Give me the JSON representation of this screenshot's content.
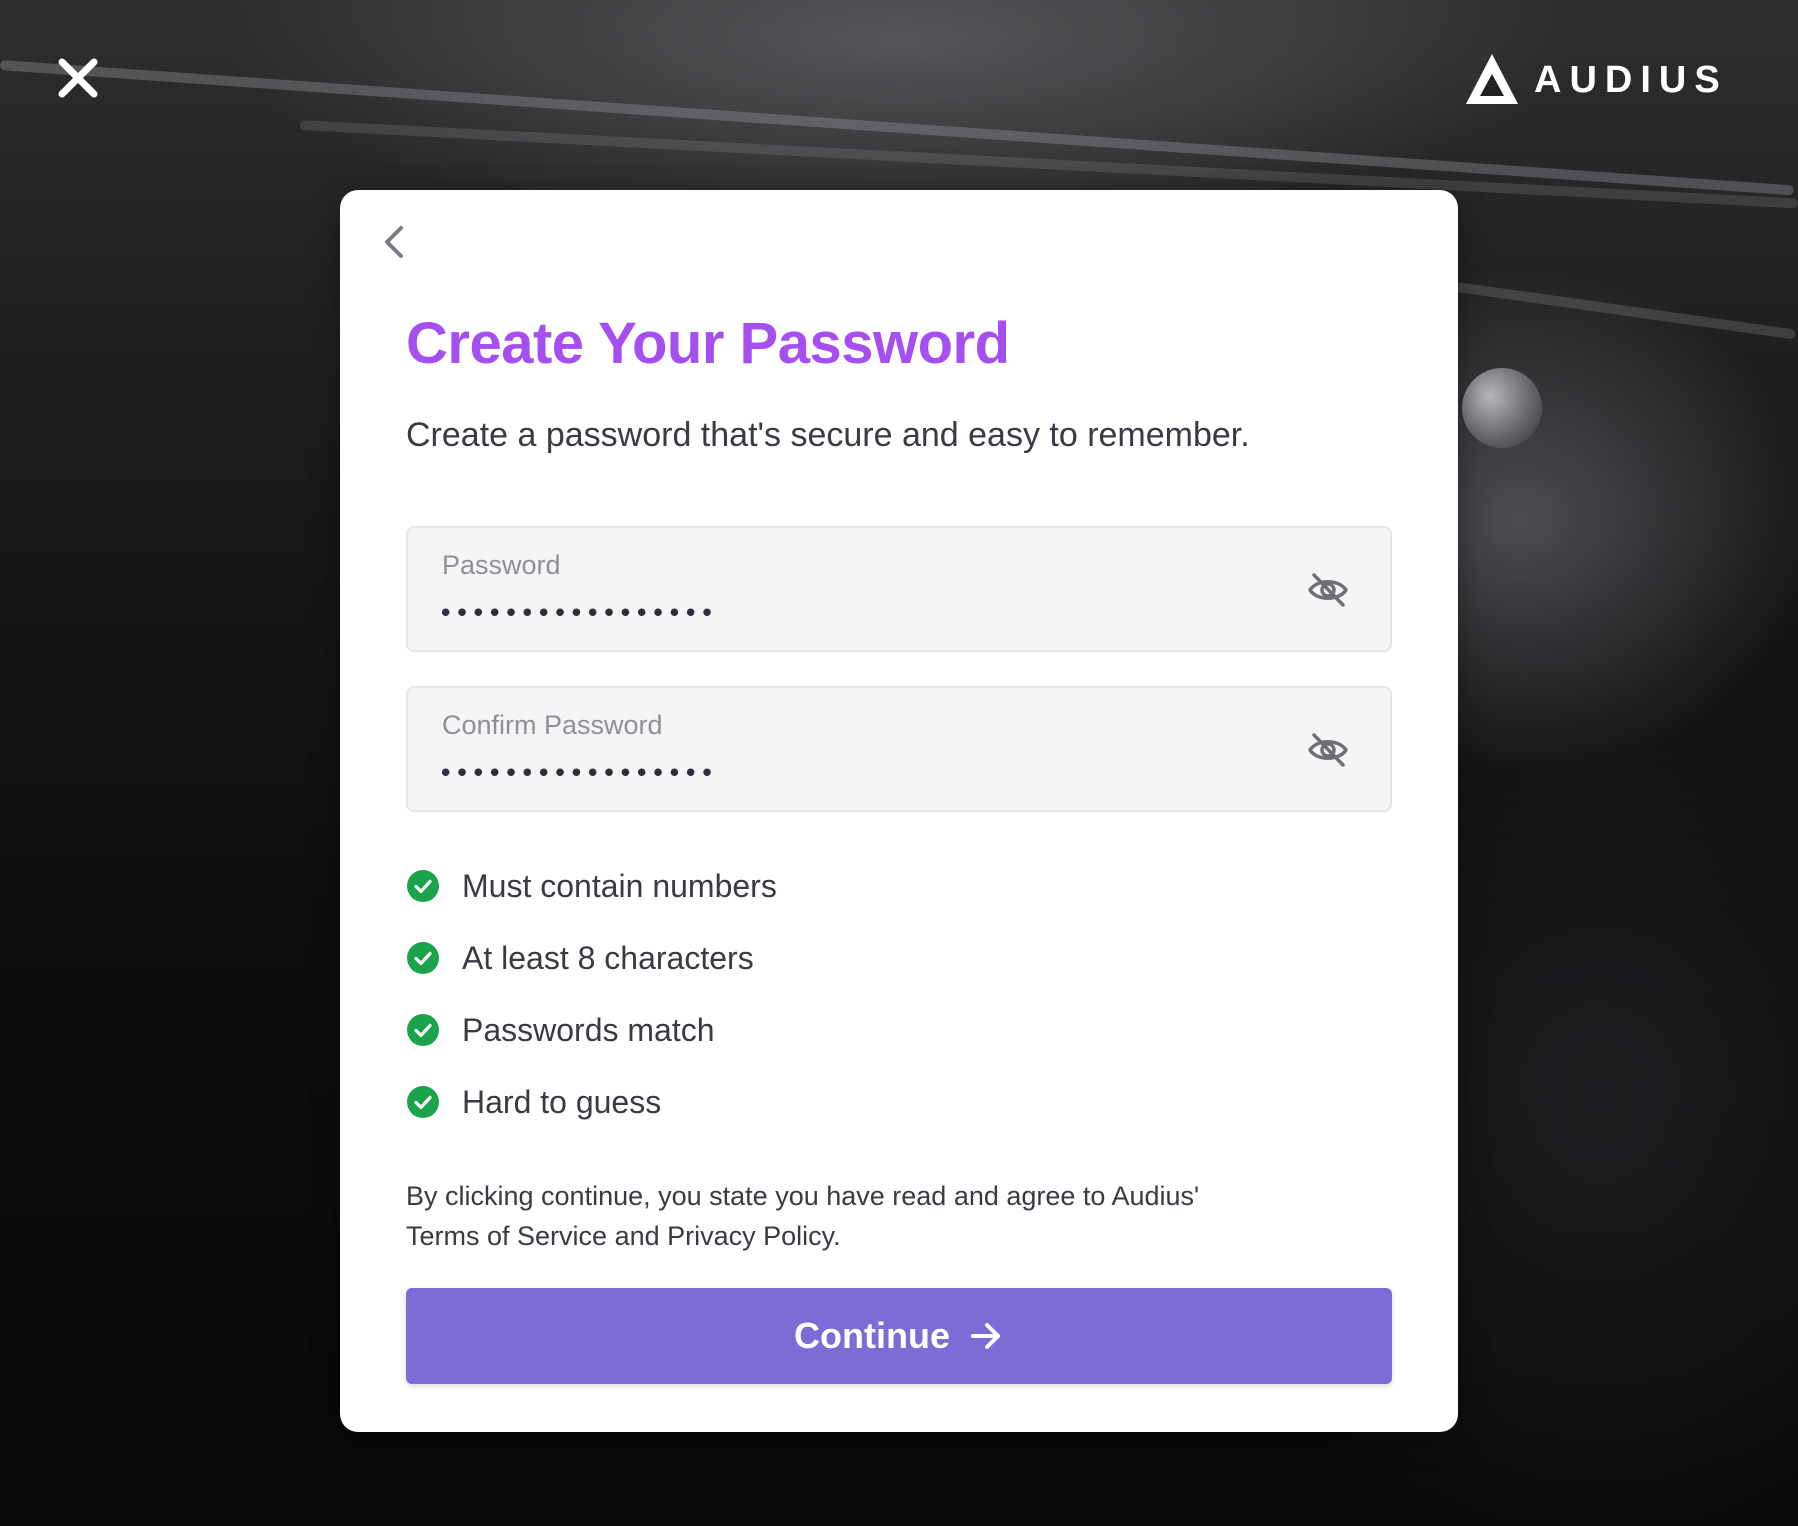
{
  "brand": {
    "name": "AUDIUS"
  },
  "modal": {
    "title": "Create Your Password",
    "subtitle": "Create a password that's secure and easy to remember.",
    "fields": [
      {
        "label": "Password",
        "value": "•••••••••••••••••"
      },
      {
        "label": "Confirm Password",
        "value": "•••••••••••••••••"
      }
    ],
    "requirements": [
      {
        "text": "Must contain numbers",
        "met": true
      },
      {
        "text": "At least 8 characters",
        "met": true
      },
      {
        "text": "Passwords match",
        "met": true
      },
      {
        "text": "Hard to guess",
        "met": true
      }
    ],
    "legal": {
      "prefix": "By clicking continue, you state you have read and agree to Audius'",
      "terms_link": "Terms of Service",
      "conjunction": " and ",
      "privacy_link": "Privacy Policy",
      "suffix": "."
    },
    "continue_label": "Continue"
  },
  "icons": {
    "close": "close-icon",
    "back": "chevron-left-icon",
    "visibility": "eye-off-icon",
    "check": "check-circle-icon",
    "arrow": "arrow-right-icon"
  },
  "colors": {
    "title": "#a64ff0",
    "button": "#7e6bd6",
    "check": "#1aa34a"
  }
}
